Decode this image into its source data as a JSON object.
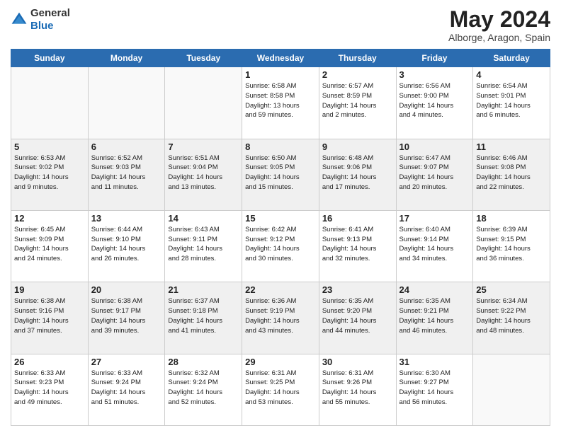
{
  "header": {
    "logo_line1": "General",
    "logo_line2": "Blue",
    "month": "May 2024",
    "location": "Alborge, Aragon, Spain"
  },
  "weekdays": [
    "Sunday",
    "Monday",
    "Tuesday",
    "Wednesday",
    "Thursday",
    "Friday",
    "Saturday"
  ],
  "weeks": [
    [
      {
        "day": "",
        "info": ""
      },
      {
        "day": "",
        "info": ""
      },
      {
        "day": "",
        "info": ""
      },
      {
        "day": "1",
        "info": "Sunrise: 6:58 AM\nSunset: 8:58 PM\nDaylight: 13 hours\nand 59 minutes."
      },
      {
        "day": "2",
        "info": "Sunrise: 6:57 AM\nSunset: 8:59 PM\nDaylight: 14 hours\nand 2 minutes."
      },
      {
        "day": "3",
        "info": "Sunrise: 6:56 AM\nSunset: 9:00 PM\nDaylight: 14 hours\nand 4 minutes."
      },
      {
        "day": "4",
        "info": "Sunrise: 6:54 AM\nSunset: 9:01 PM\nDaylight: 14 hours\nand 6 minutes."
      }
    ],
    [
      {
        "day": "5",
        "info": "Sunrise: 6:53 AM\nSunset: 9:02 PM\nDaylight: 14 hours\nand 9 minutes."
      },
      {
        "day": "6",
        "info": "Sunrise: 6:52 AM\nSunset: 9:03 PM\nDaylight: 14 hours\nand 11 minutes."
      },
      {
        "day": "7",
        "info": "Sunrise: 6:51 AM\nSunset: 9:04 PM\nDaylight: 14 hours\nand 13 minutes."
      },
      {
        "day": "8",
        "info": "Sunrise: 6:50 AM\nSunset: 9:05 PM\nDaylight: 14 hours\nand 15 minutes."
      },
      {
        "day": "9",
        "info": "Sunrise: 6:48 AM\nSunset: 9:06 PM\nDaylight: 14 hours\nand 17 minutes."
      },
      {
        "day": "10",
        "info": "Sunrise: 6:47 AM\nSunset: 9:07 PM\nDaylight: 14 hours\nand 20 minutes."
      },
      {
        "day": "11",
        "info": "Sunrise: 6:46 AM\nSunset: 9:08 PM\nDaylight: 14 hours\nand 22 minutes."
      }
    ],
    [
      {
        "day": "12",
        "info": "Sunrise: 6:45 AM\nSunset: 9:09 PM\nDaylight: 14 hours\nand 24 minutes."
      },
      {
        "day": "13",
        "info": "Sunrise: 6:44 AM\nSunset: 9:10 PM\nDaylight: 14 hours\nand 26 minutes."
      },
      {
        "day": "14",
        "info": "Sunrise: 6:43 AM\nSunset: 9:11 PM\nDaylight: 14 hours\nand 28 minutes."
      },
      {
        "day": "15",
        "info": "Sunrise: 6:42 AM\nSunset: 9:12 PM\nDaylight: 14 hours\nand 30 minutes."
      },
      {
        "day": "16",
        "info": "Sunrise: 6:41 AM\nSunset: 9:13 PM\nDaylight: 14 hours\nand 32 minutes."
      },
      {
        "day": "17",
        "info": "Sunrise: 6:40 AM\nSunset: 9:14 PM\nDaylight: 14 hours\nand 34 minutes."
      },
      {
        "day": "18",
        "info": "Sunrise: 6:39 AM\nSunset: 9:15 PM\nDaylight: 14 hours\nand 36 minutes."
      }
    ],
    [
      {
        "day": "19",
        "info": "Sunrise: 6:38 AM\nSunset: 9:16 PM\nDaylight: 14 hours\nand 37 minutes."
      },
      {
        "day": "20",
        "info": "Sunrise: 6:38 AM\nSunset: 9:17 PM\nDaylight: 14 hours\nand 39 minutes."
      },
      {
        "day": "21",
        "info": "Sunrise: 6:37 AM\nSunset: 9:18 PM\nDaylight: 14 hours\nand 41 minutes."
      },
      {
        "day": "22",
        "info": "Sunrise: 6:36 AM\nSunset: 9:19 PM\nDaylight: 14 hours\nand 43 minutes."
      },
      {
        "day": "23",
        "info": "Sunrise: 6:35 AM\nSunset: 9:20 PM\nDaylight: 14 hours\nand 44 minutes."
      },
      {
        "day": "24",
        "info": "Sunrise: 6:35 AM\nSunset: 9:21 PM\nDaylight: 14 hours\nand 46 minutes."
      },
      {
        "day": "25",
        "info": "Sunrise: 6:34 AM\nSunset: 9:22 PM\nDaylight: 14 hours\nand 48 minutes."
      }
    ],
    [
      {
        "day": "26",
        "info": "Sunrise: 6:33 AM\nSunset: 9:23 PM\nDaylight: 14 hours\nand 49 minutes."
      },
      {
        "day": "27",
        "info": "Sunrise: 6:33 AM\nSunset: 9:24 PM\nDaylight: 14 hours\nand 51 minutes."
      },
      {
        "day": "28",
        "info": "Sunrise: 6:32 AM\nSunset: 9:24 PM\nDaylight: 14 hours\nand 52 minutes."
      },
      {
        "day": "29",
        "info": "Sunrise: 6:31 AM\nSunset: 9:25 PM\nDaylight: 14 hours\nand 53 minutes."
      },
      {
        "day": "30",
        "info": "Sunrise: 6:31 AM\nSunset: 9:26 PM\nDaylight: 14 hours\nand 55 minutes."
      },
      {
        "day": "31",
        "info": "Sunrise: 6:30 AM\nSunset: 9:27 PM\nDaylight: 14 hours\nand 56 minutes."
      },
      {
        "day": "",
        "info": ""
      }
    ]
  ]
}
